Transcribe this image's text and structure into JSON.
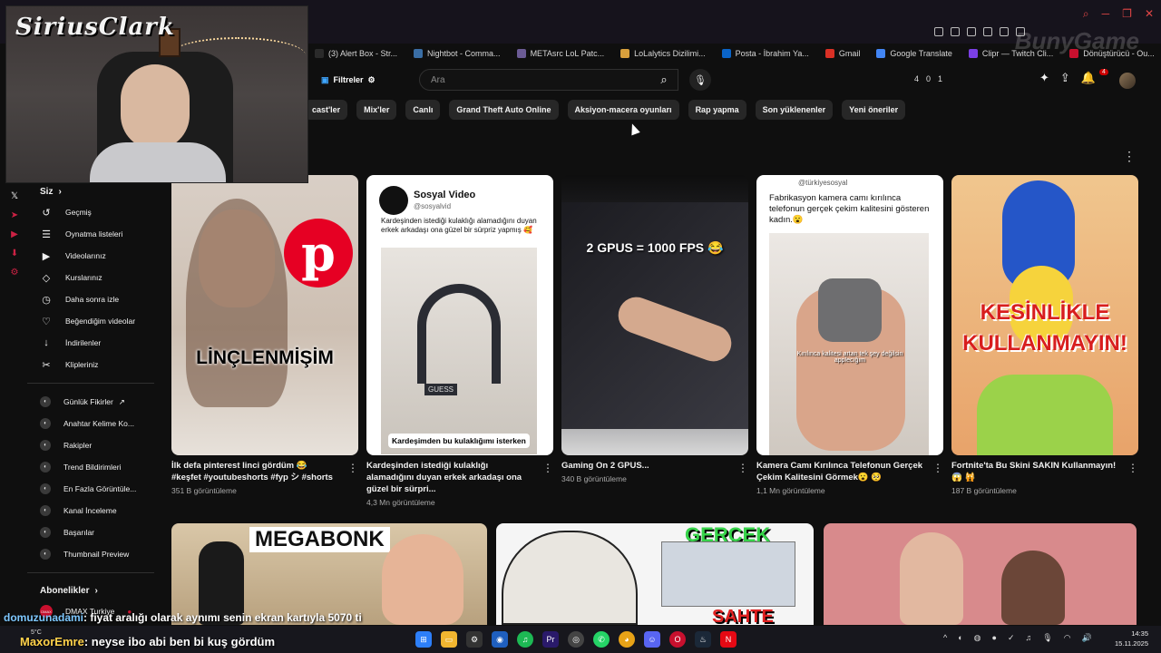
{
  "bookmarks": [
    {
      "label": "(3) Alert Box - Str...",
      "color": "#2a2a2a"
    },
    {
      "label": "Nightbot - Comma...",
      "color": "#3a6ea5"
    },
    {
      "label": "METAsrc LoL Patc...",
      "color": "#6b5b95"
    },
    {
      "label": "LoLalytics Dizilimi...",
      "color": "#d8a03c"
    },
    {
      "label": "Posta - İbrahim Ya...",
      "color": "#0a64c8"
    },
    {
      "label": "Gmail",
      "color": "#d93025"
    },
    {
      "label": "Google Translate",
      "color": "#4285f4"
    },
    {
      "label": "Clipr — Twitch Cli...",
      "color": "#7b3fe4"
    },
    {
      "label": "Dönüştürücü - Ou...",
      "color": "#c8102e"
    }
  ],
  "overlay_brand": "BunyGame",
  "header": {
    "filters_label": "Filtreler",
    "search_placeholder": "Ara",
    "stats": [
      "4",
      "0",
      "1"
    ],
    "notif_count": "4"
  },
  "chips": [
    "cast'ler",
    "Mix'ler",
    "Canlı",
    "Grand Theft Auto Online",
    "Aksiyon-macera oyunları",
    "Rap yapma",
    "Son yüklenenler",
    "Yeni öneriler"
  ],
  "sidebar": {
    "you_label": "Siz",
    "items": [
      {
        "label": "Geçmiş",
        "icon": "history-icon",
        "glyph": "↺"
      },
      {
        "label": "Oynatma listeleri",
        "icon": "playlist-icon",
        "glyph": "☰"
      },
      {
        "label": "Videolarınız",
        "icon": "video-icon",
        "glyph": "▶"
      },
      {
        "label": "Kurslarınız",
        "icon": "courses-icon",
        "glyph": "◇"
      },
      {
        "label": "Daha sonra izle",
        "icon": "clock-icon",
        "glyph": "◷"
      },
      {
        "label": "Beğendiğim videolar",
        "icon": "like-icon",
        "glyph": "♡"
      },
      {
        "label": "İndirilenler",
        "icon": "download-icon",
        "glyph": "↓"
      },
      {
        "label": "Klipleriniz",
        "icon": "scissors-icon",
        "glyph": "✂"
      }
    ],
    "extensions": [
      {
        "label": "Günlük Fikirler"
      },
      {
        "label": "Anahtar Kelime Ko..."
      },
      {
        "label": "Rakipler"
      },
      {
        "label": "Trend Bildirimleri"
      },
      {
        "label": "En Fazla Görüntüle..."
      },
      {
        "label": "Kanal İnceleme"
      },
      {
        "label": "Başarılar"
      },
      {
        "label": "Thumbnail Preview"
      }
    ],
    "subscriptions_label": "Abonelikler",
    "subscriptions": [
      {
        "label": "DMAX Turkiye",
        "avatar_text": "DMAX"
      }
    ]
  },
  "shorts": [
    {
      "title": "İlk defa pinterest linci gördüm 😂 #keşfet #youtubeshorts #fyp シ #shorts",
      "views": "351 B görüntüleme",
      "overlay": "LİNÇLENMİŞİM"
    },
    {
      "title": "Kardeşinden istediği kulaklığı alamadığını duyan erkek arkadaşı ona güzel bir sürpri...",
      "views": "4,3 Mn görüntüleme",
      "brand": "Sosyal Video",
      "handle": "@sosyalvid",
      "caption": "Kardeşinden istediği kulaklığı alamadığını duyan erkek arkadaşı ona güzel bir sürpriz yapmış 🥰",
      "subtitle": "Kardeşimden bu kulaklığımı isterken",
      "product_text": "GUESS"
    },
    {
      "title": "Gaming On 2 GPUS...",
      "views": "340 B görüntüleme",
      "overlay": "2 GPUS = 1000 FPS 😂"
    },
    {
      "title": "Kamera Camı Kırılınca Telefonun Gerçek Çekim Kalitesini Görmek😮 🥺",
      "views": "1,1 Mn görüntüleme",
      "handle": "@türkiyesosyal",
      "caption": "Fabrikasyon kamera camı kırılınca telefonun gerçek çekim kalitesini gösteren kadın.😮",
      "subtitle": "Kırılınca kalitesi artan tek şey değilsin applecığım"
    },
    {
      "title": "Fortnite'ta Bu Skini SAKIN Kullanmayın! 😱 🙀",
      "views": "187 B görüntüleme",
      "overlay1": "KESİNLİKLE",
      "overlay2": "KULLANMAYIN!"
    }
  ],
  "videos": [
    {
      "overlay": "MEGABONK"
    },
    {
      "overlay": "GERÇEK",
      "overlay2": "SAHTE"
    },
    {
      "overlay": ""
    }
  ],
  "webcam_logo": "SiriusClark",
  "chat": [
    {
      "user": "domuzunadami",
      "message": ": fiyat aralığı olarak aynımı senin ekran kartıyla 5070 ti"
    },
    {
      "user": "MaxorEmre",
      "message": ": neyse ibo abi ben bi kuş gördüm"
    }
  ],
  "weather": "5°C",
  "clock": {
    "time": "14:35",
    "date": "15.11.2025"
  }
}
